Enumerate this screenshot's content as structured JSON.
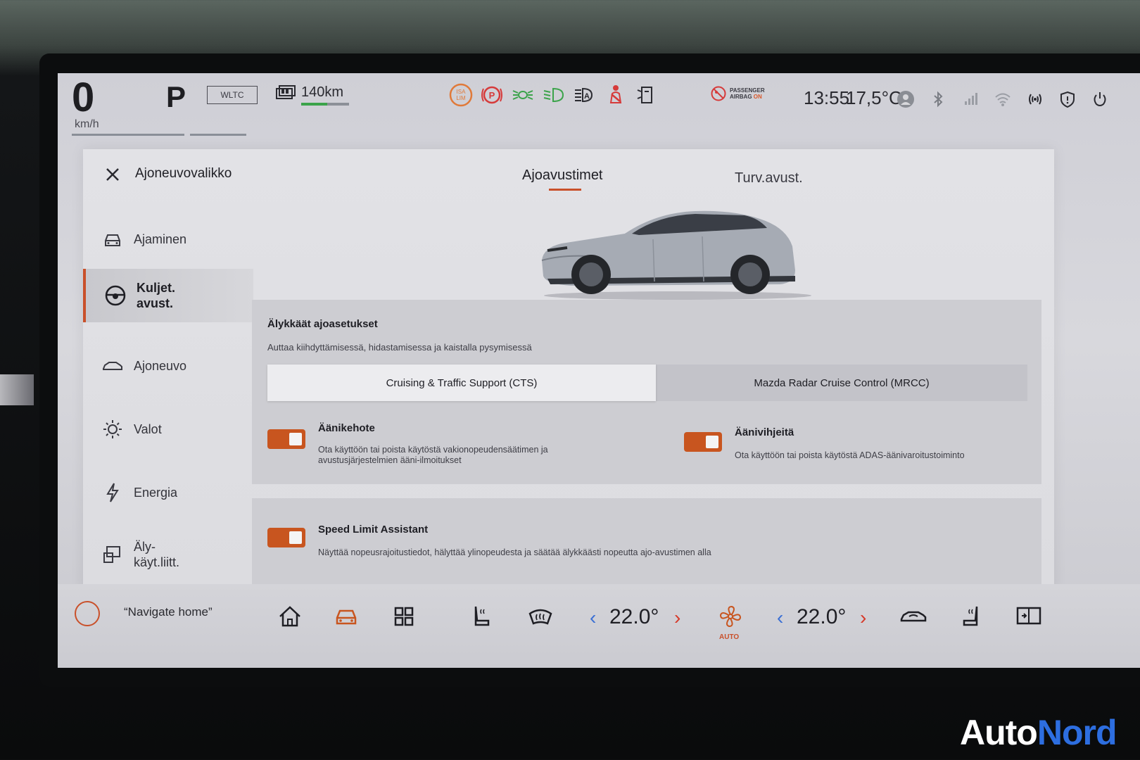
{
  "status": {
    "speed": "0",
    "speed_unit": "km/h",
    "gear": "P",
    "wltc": "WLTC",
    "range": "140km",
    "range_fraction": 0.55,
    "time": "13:55",
    "temperature": "17,5°C",
    "isa_icon": "ISA\nLIM",
    "airbag_text": "PASSENGER",
    "airbag_text2": "AIRBAG",
    "airbag_state": "ON"
  },
  "menu": {
    "title": "Ajoneuvovalikko",
    "items": [
      {
        "label": "Ajaminen",
        "icon": "car-front-icon"
      },
      {
        "label": "Kuljet.\navust.",
        "icon": "steering-wheel-icon",
        "active": true
      },
      {
        "label": "Ajoneuvo",
        "icon": "car-side-icon"
      },
      {
        "label": "Valot",
        "icon": "sun-icon"
      },
      {
        "label": "Energia",
        "icon": "lightning-icon"
      },
      {
        "label": "Äly-\nkäyt.liitt.",
        "icon": "smart-device-icon"
      }
    ]
  },
  "tabs": [
    "Ajoavustimet",
    "Turv.avust."
  ],
  "smart_settings": {
    "title": "Älykkäät ajoasetukset",
    "description": "Auttaa kiihdyttämisessä, hidastamisessa ja kaistalla pysymisessä",
    "segments": [
      "Cruising & Traffic Support (CTS)",
      "Mazda Radar Cruise Control (MRCC)"
    ],
    "options": [
      {
        "title": "Äänikehote",
        "description": "Ota käyttöön tai poista käytöstä vakionopeudensäätimen ja\navustusjärjestelmien ääni-ilmoitukset",
        "enabled": true
      },
      {
        "title": "Äänivihjeitä",
        "description": "Ota käyttöön tai poista käytöstä ADAS-äänivaroitustoiminto",
        "enabled": true
      }
    ]
  },
  "speed_limit": {
    "title": "Speed Limit Assistant",
    "description": "Näyttää nopeusrajoitustiedot, hälyttää ylinopeudesta ja säätää älykkäästi nopeutta ajo-avustimen alla",
    "enabled": true
  },
  "dock": {
    "voice_hint": "“Navigate home”",
    "temp_left": "22.0°",
    "temp_right": "22.0°",
    "fan_mode": "AUTO"
  },
  "watermark": {
    "part1": "Auto",
    "part2": "Nord"
  },
  "colors": {
    "accent": "#c8551f",
    "temp_down": "#3a6fd4",
    "temp_up": "#d63a2a",
    "range_ok": "#3ba34a"
  }
}
